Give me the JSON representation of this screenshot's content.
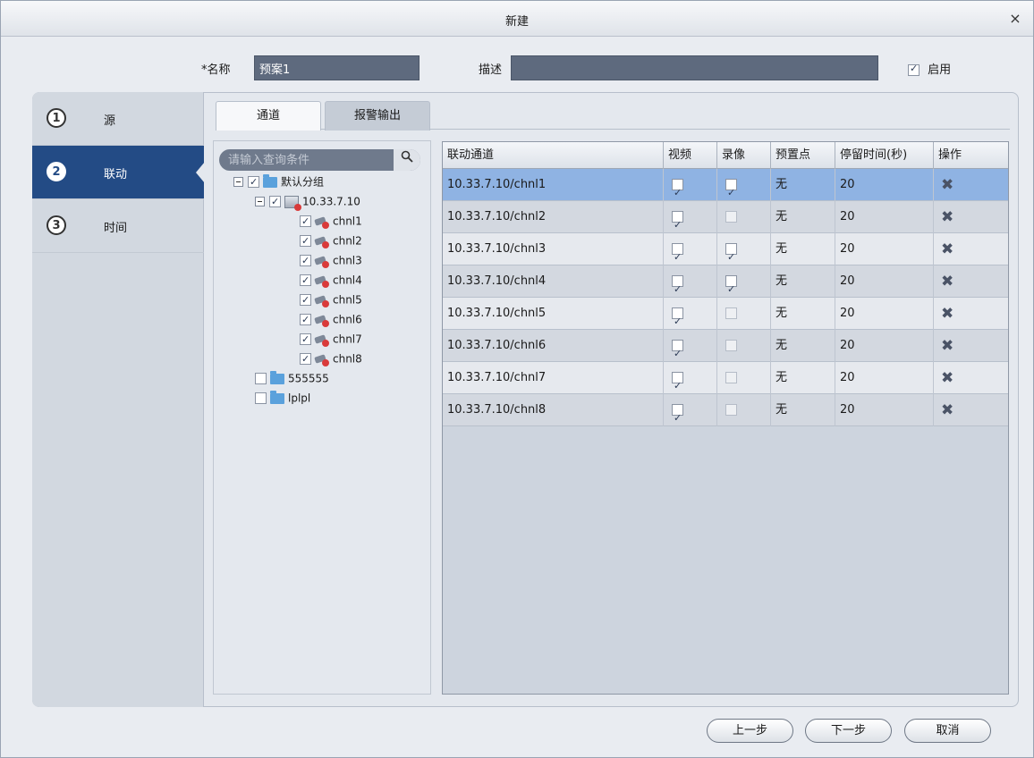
{
  "window": {
    "title": "新建",
    "close_glyph": "×"
  },
  "form": {
    "name_label": "*名称",
    "name_value": "预案1",
    "desc_label": "描述",
    "desc_value": "",
    "enable_label": "启用",
    "enable_checked": true
  },
  "steps": [
    {
      "num": "1",
      "label": "源"
    },
    {
      "num": "2",
      "label": "联动"
    },
    {
      "num": "3",
      "label": "时间"
    }
  ],
  "tabs": [
    {
      "label": "通道"
    },
    {
      "label": "报警输出"
    }
  ],
  "tree": {
    "search_placeholder": "请输入查询条件",
    "search_icon": "magnifier-icon",
    "root": {
      "label": "默认分组",
      "checked": true
    },
    "device": {
      "label": "10.33.7.10",
      "checked": true
    },
    "channels": [
      "chnl1",
      "chnl2",
      "chnl3",
      "chnl4",
      "chnl5",
      "chnl6",
      "chnl7",
      "chnl8"
    ],
    "groups": [
      "555555",
      "lplpl"
    ]
  },
  "grid": {
    "headers": [
      "联动通道",
      "视频",
      "录像",
      "预置点",
      "停留时间(秒)",
      "操作"
    ],
    "rows": [
      {
        "channel": "10.33.7.10/chnl1",
        "video": true,
        "record": true,
        "preset": "无",
        "dwell": "20"
      },
      {
        "channel": "10.33.7.10/chnl2",
        "video": true,
        "record": false,
        "preset": "无",
        "dwell": "20"
      },
      {
        "channel": "10.33.7.10/chnl3",
        "video": true,
        "record": true,
        "preset": "无",
        "dwell": "20"
      },
      {
        "channel": "10.33.7.10/chnl4",
        "video": true,
        "record": true,
        "preset": "无",
        "dwell": "20"
      },
      {
        "channel": "10.33.7.10/chnl5",
        "video": true,
        "record": false,
        "preset": "无",
        "dwell": "20"
      },
      {
        "channel": "10.33.7.10/chnl6",
        "video": true,
        "record": false,
        "preset": "无",
        "dwell": "20"
      },
      {
        "channel": "10.33.7.10/chnl7",
        "video": true,
        "record": false,
        "preset": "无",
        "dwell": "20"
      },
      {
        "channel": "10.33.7.10/chnl8",
        "video": true,
        "record": false,
        "preset": "无",
        "dwell": "20"
      }
    ],
    "delete_icon": "delete-icon",
    "delete_glyph": "✖"
  },
  "buttons": {
    "prev": "上一步",
    "next": "下一步",
    "cancel": "取消"
  },
  "colors": {
    "active_step": "#234b85",
    "selected_row": "#8fb3e3",
    "input_bg": "#5e6a7e"
  }
}
